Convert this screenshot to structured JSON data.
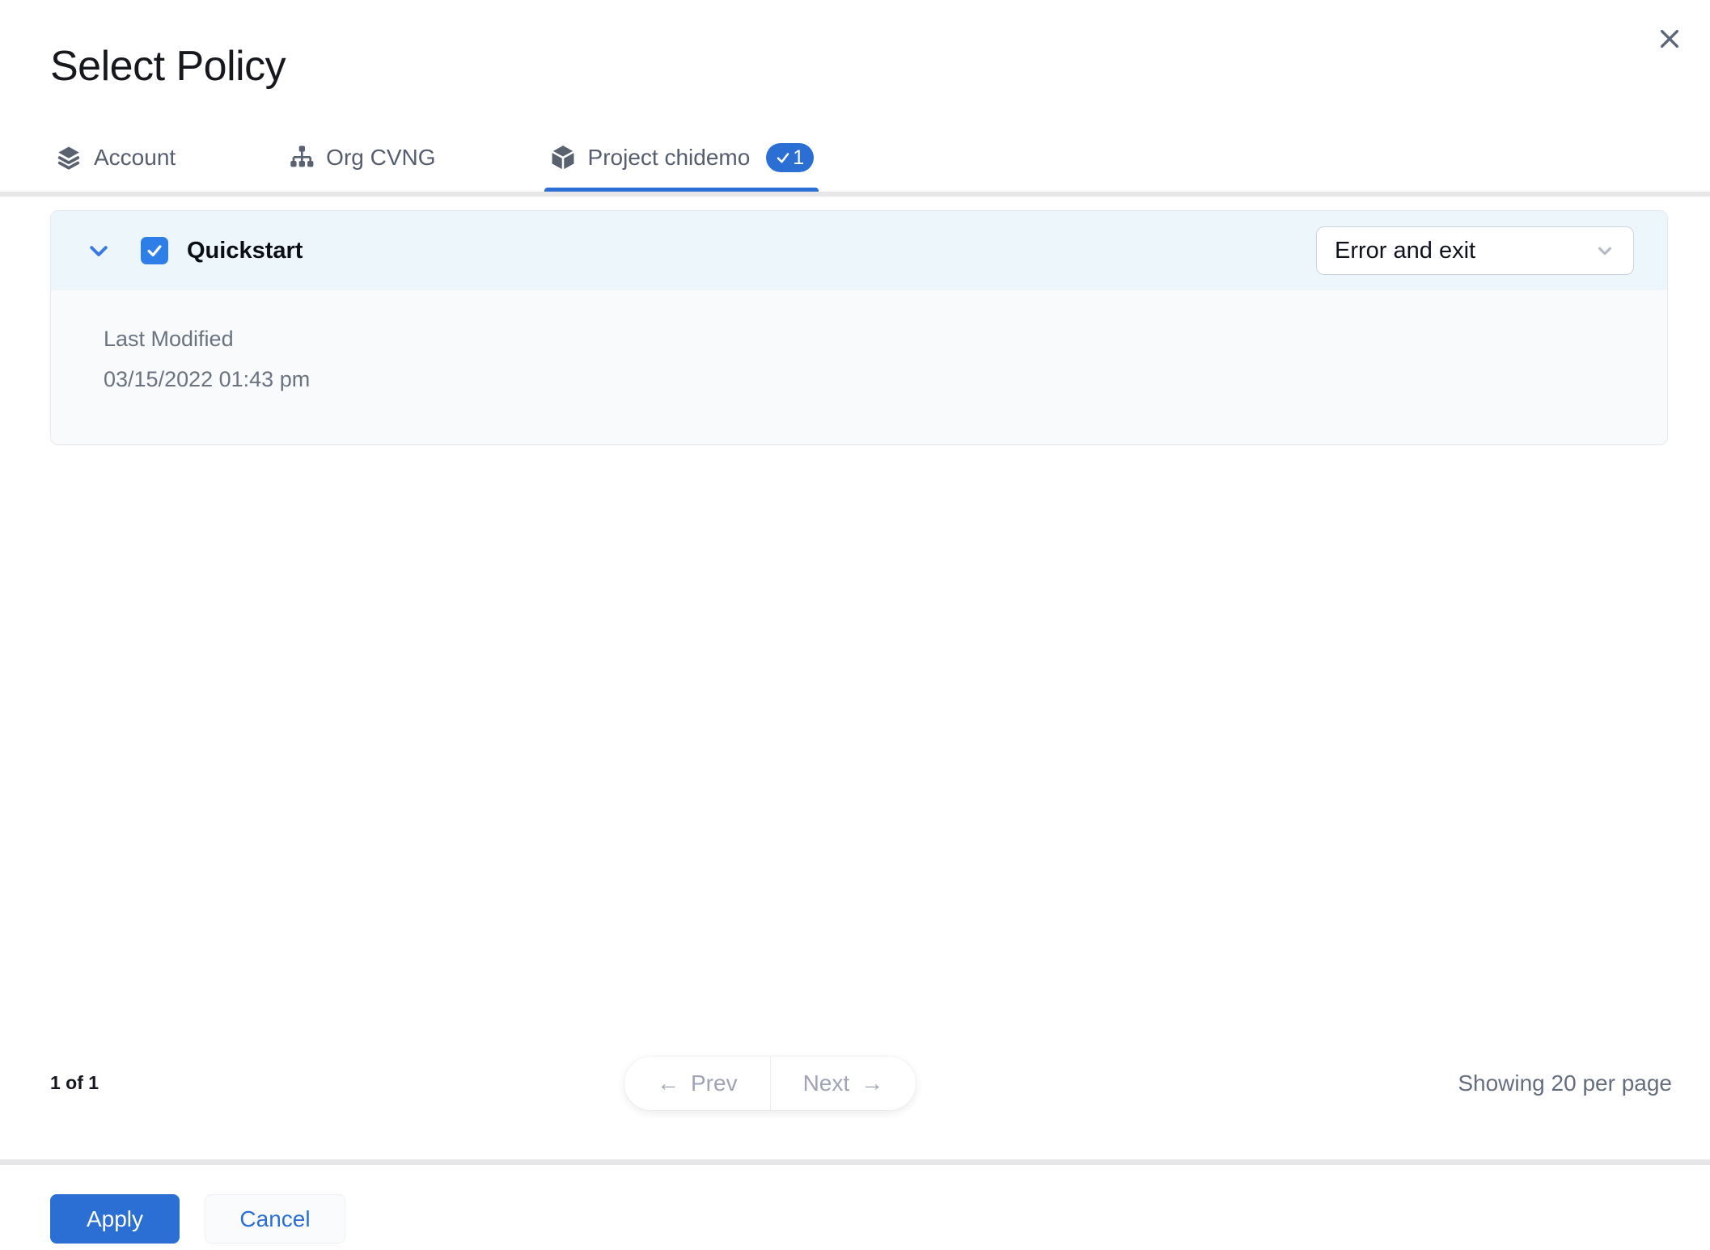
{
  "modal": {
    "title": "Select Policy"
  },
  "tabs": [
    {
      "label": "Account",
      "icon": "layers-icon",
      "active": false
    },
    {
      "label": "Org CVNG",
      "icon": "org-hierarchy-icon",
      "active": false
    },
    {
      "label": "Project chidemo",
      "icon": "cube-icon",
      "active": true,
      "badge": "1"
    }
  ],
  "policy": {
    "name": "Quickstart",
    "checked": true,
    "action_select": {
      "value": "Error and exit"
    },
    "details": {
      "last_modified_label": "Last Modified",
      "last_modified_value": "03/15/2022 01:43 pm"
    }
  },
  "pagination": {
    "page_info": "1 of 1",
    "prev_icon": "←",
    "prev_label": "Prev",
    "next_label": "Next",
    "next_icon": "→",
    "showing": "Showing 20 per page"
  },
  "footer": {
    "apply_label": "Apply",
    "cancel_label": "Cancel"
  },
  "colors": {
    "primary_blue": "#2b6fd4",
    "checkbox_blue": "#2e7ee7",
    "tab_text": "#555d6e",
    "header_row_bg": "#edf7fb",
    "card_body_bg": "#f9fafc",
    "muted_text": "#6b7380",
    "pagination_text": "#9fa3b5",
    "divider": "#e7e7e9"
  }
}
